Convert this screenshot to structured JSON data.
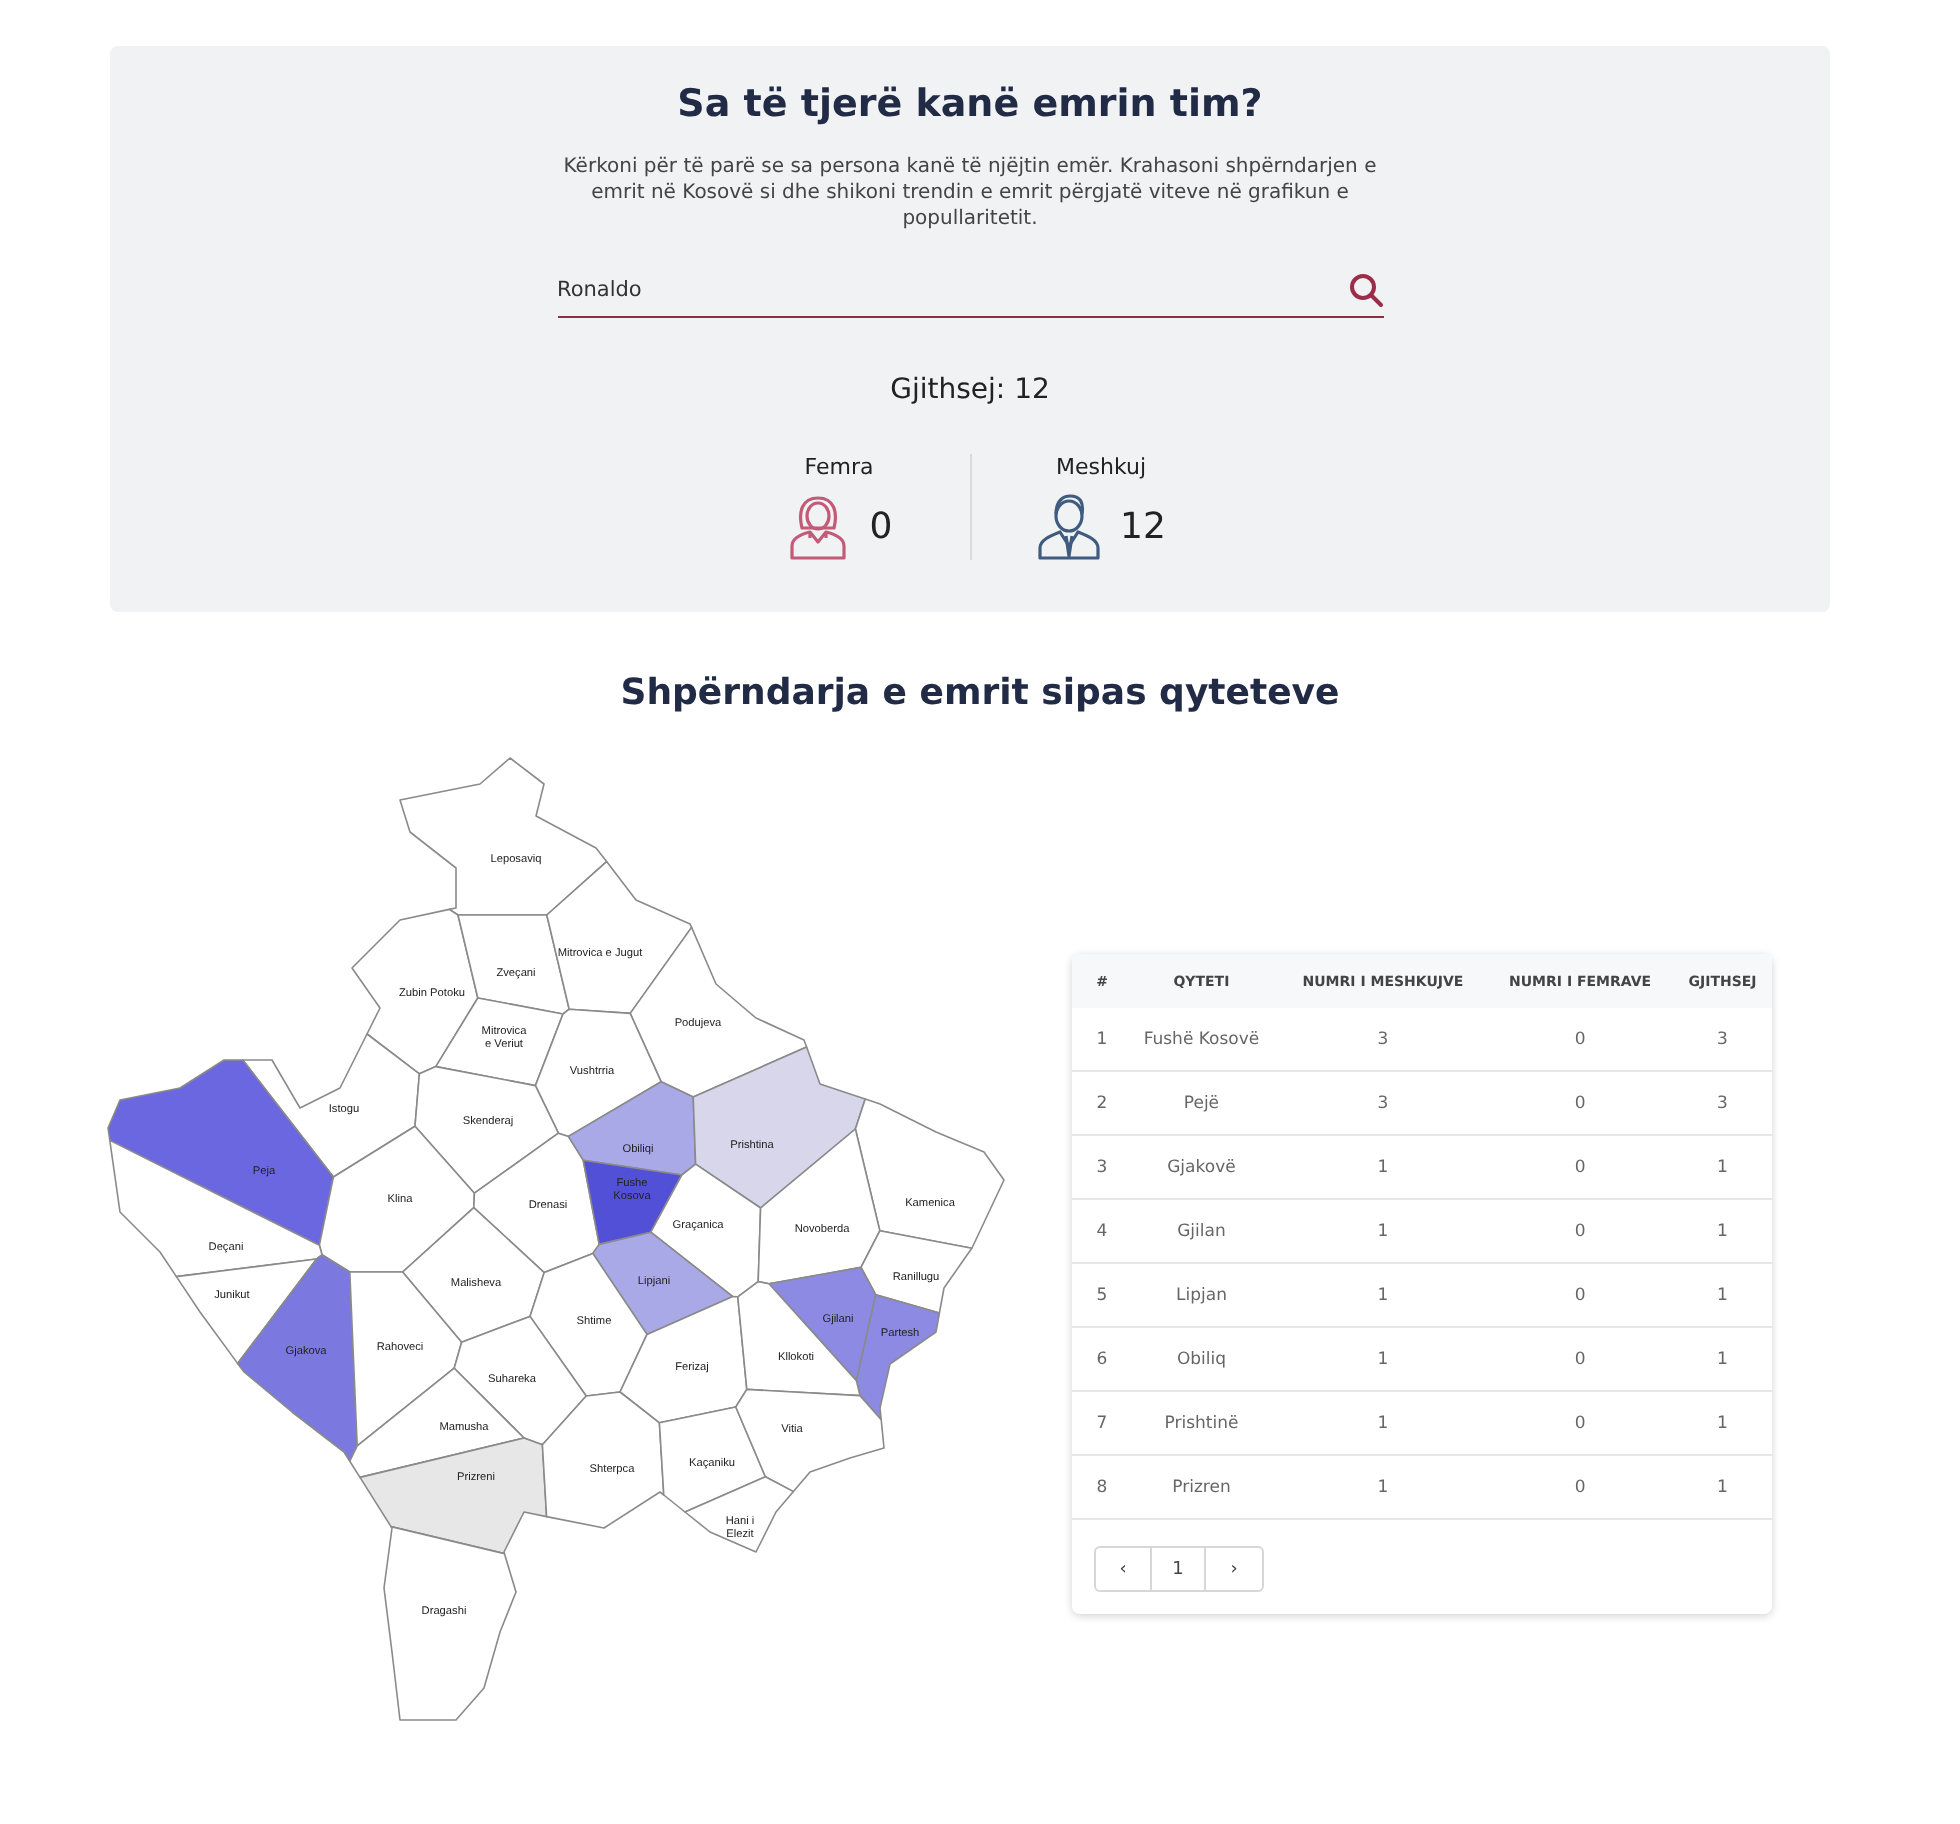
{
  "search_panel": {
    "title": "Sa të tjerë kanë emrin tim?",
    "description": "Kërkoni për të parë se sa persona kanë të njëjtin emër. Krahasoni shpërndarjen e emrit në Kosovë si dhe shikoni trendin e emrit përgjatë viteve në grafikun e popullaritetit.",
    "search": {
      "value": "Ronaldo"
    },
    "total": "Gjithsej: 12",
    "stats": [
      {
        "kind": "female",
        "label": "Femra",
        "value": "0"
      },
      {
        "kind": "male",
        "label": "Meshkuj",
        "value": "12"
      }
    ]
  },
  "distribution": {
    "title": "Shpërndarja e emrit sipas qyteteve",
    "map": {
      "regions": [
        {
          "label_lines": [
            "Leposaviq"
          ],
          "color": "#ffffff"
        },
        {
          "label_lines": [
            "Zubin Potoku"
          ],
          "color": "#ffffff"
        },
        {
          "label_lines": [
            "Zveçani"
          ],
          "color": "#ffffff"
        },
        {
          "label_lines": [
            "Mitrovica",
            "e Veriut"
          ],
          "color": "#ffffff"
        },
        {
          "label_lines": [
            "Mitrovica e Jugut"
          ],
          "color": "#ffffff"
        },
        {
          "label_lines": [
            "Podujeva"
          ],
          "color": "#ffffff"
        },
        {
          "label_lines": [
            "Vushtrria"
          ],
          "color": "#ffffff"
        },
        {
          "label_lines": [
            "Istogu"
          ],
          "color": "#ffffff"
        },
        {
          "label_lines": [
            "Skenderaj"
          ],
          "color": "#ffffff"
        },
        {
          "label_lines": [
            "Peja"
          ],
          "color": "#6a67e0"
        },
        {
          "label_lines": [
            "Klina"
          ],
          "color": "#ffffff"
        },
        {
          "label_lines": [
            "Drenasi"
          ],
          "color": "#ffffff"
        },
        {
          "label_lines": [
            "Obiliqi"
          ],
          "color": "#aaa9e8"
        },
        {
          "label_lines": [
            "Prishtina"
          ],
          "color": "#d7d6ea"
        },
        {
          "label_lines": [
            "Fushe",
            "Kosova"
          ],
          "color": "#5350d8"
        },
        {
          "label_lines": [
            "Kamenica"
          ],
          "color": "#ffffff"
        },
        {
          "label_lines": [
            "Graçanica"
          ],
          "color": "#ffffff"
        },
        {
          "label_lines": [
            "Novoberda"
          ],
          "color": "#ffffff"
        },
        {
          "label_lines": [
            "Deçani"
          ],
          "color": "#ffffff"
        },
        {
          "label_lines": [
            "Junikut"
          ],
          "color": "#ffffff"
        },
        {
          "label_lines": [
            "Malisheva"
          ],
          "color": "#ffffff"
        },
        {
          "label_lines": [
            "Lipjani"
          ],
          "color": "#aaa9e8"
        },
        {
          "label_lines": [
            "Ranillugu"
          ],
          "color": "#ffffff"
        },
        {
          "label_lines": [
            "Gjilani"
          ],
          "color": "#8d8ae4"
        },
        {
          "label_lines": [
            "Partesh"
          ],
          "color": "#8d8ae4"
        },
        {
          "label_lines": [
            "Gjakova"
          ],
          "color": "#7b78e0"
        },
        {
          "label_lines": [
            "Rahoveci"
          ],
          "color": "#ffffff"
        },
        {
          "label_lines": [
            "Shtime"
          ],
          "color": "#ffffff"
        },
        {
          "label_lines": [
            "Ferizaj"
          ],
          "color": "#ffffff"
        },
        {
          "label_lines": [
            "Kllokoti"
          ],
          "color": "#ffffff"
        },
        {
          "label_lines": [
            "Suhareka"
          ],
          "color": "#ffffff"
        },
        {
          "label_lines": [
            "Mamusha"
          ],
          "color": "#ffffff"
        },
        {
          "label_lines": [
            "Prizreni"
          ],
          "color": "#e6e7e6"
        },
        {
          "label_lines": [
            "Shterpca"
          ],
          "color": "#ffffff"
        },
        {
          "label_lines": [
            "Kaçaniku"
          ],
          "color": "#ffffff"
        },
        {
          "label_lines": [
            "Vitia"
          ],
          "color": "#ffffff"
        },
        {
          "label_lines": [
            "Hani i",
            "Elezit"
          ],
          "color": "#ffffff"
        },
        {
          "label_lines": [
            "Dragashi"
          ],
          "color": "#ffffff"
        }
      ]
    },
    "table": {
      "columns": [
        "#",
        "QYTETI",
        "NUMRI I MESHKUJVE",
        "NUMRI I FEMRAVE",
        "GJITHSEJ"
      ],
      "rows": [
        [
          "1",
          "Fushë Kosovë",
          "3",
          "0",
          "3"
        ],
        [
          "2",
          "Pejë",
          "3",
          "0",
          "3"
        ],
        [
          "3",
          "Gjakovë",
          "1",
          "0",
          "1"
        ],
        [
          "4",
          "Gjilan",
          "1",
          "0",
          "1"
        ],
        [
          "5",
          "Lipjan",
          "1",
          "0",
          "1"
        ],
        [
          "6",
          "Obiliq",
          "1",
          "0",
          "1"
        ],
        [
          "7",
          "Prishtinë",
          "1",
          "0",
          "1"
        ],
        [
          "8",
          "Prizren",
          "1",
          "0",
          "1"
        ]
      ],
      "pagination": {
        "prev": "‹",
        "page": "1",
        "next": "›"
      }
    }
  }
}
